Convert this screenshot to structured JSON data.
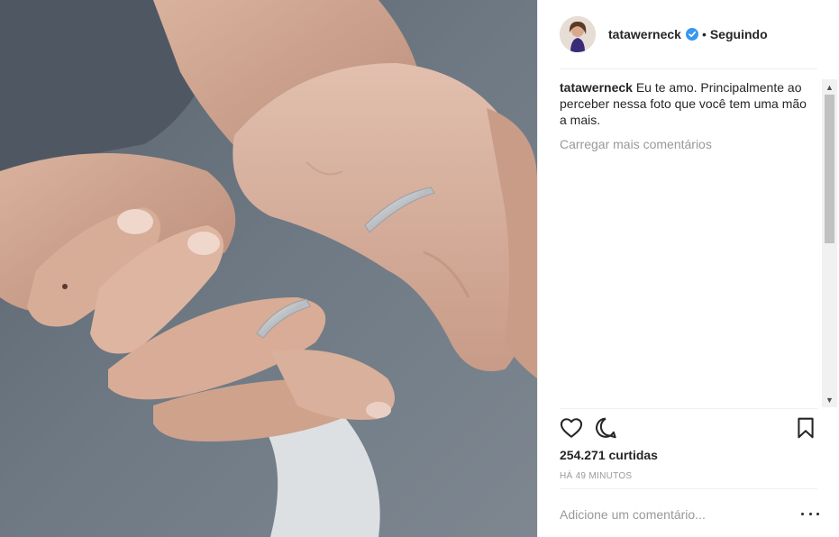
{
  "post": {
    "username": "tatawerneck",
    "follow_status": "Seguindo",
    "separator": "•",
    "caption_user": "tatawerneck",
    "caption_text": "Eu te amo. Principalmente ao perceber nessa foto que você tem uma mão a mais.",
    "load_more": "Carregar mais comentários",
    "likes": "254.271 curtidas",
    "timestamp": "HÁ 49 MINUTOS",
    "comment_placeholder": "Adicione um comentário..."
  },
  "icons": {
    "verified": "verified-badge-icon",
    "like": "heart-icon",
    "comment": "comment-bubble-icon",
    "save": "bookmark-icon",
    "more": "more-options-icon"
  },
  "colors": {
    "verified_blue": "#3897f0",
    "muted_text": "#999999",
    "text": "#262626",
    "divider": "#efefef"
  }
}
